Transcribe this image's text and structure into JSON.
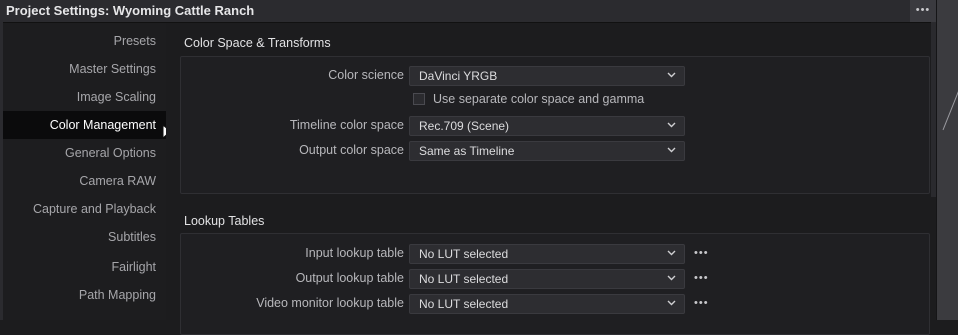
{
  "title": "Project Settings:  Wyoming Cattle Ranch",
  "header": {
    "more_label": "•••"
  },
  "sidebar": {
    "items": [
      {
        "label": "Presets",
        "active": false
      },
      {
        "label": "Master Settings",
        "active": false
      },
      {
        "label": "Image Scaling",
        "active": false
      },
      {
        "label": "Color Management",
        "active": true
      },
      {
        "label": "General Options",
        "active": false
      },
      {
        "label": "Camera RAW",
        "active": false
      },
      {
        "label": "Capture and Playback",
        "active": false
      },
      {
        "label": "Subtitles",
        "active": false
      },
      {
        "label": "Fairlight",
        "active": false
      },
      {
        "label": "Path Mapping",
        "active": false
      }
    ]
  },
  "color_space": {
    "section_title": "Color Space & Transforms",
    "color_science_label": "Color science",
    "color_science_value": "DaVinci YRGB",
    "separate_checkbox_label": "Use separate color space and gamma",
    "separate_checked": false,
    "timeline_label": "Timeline color space",
    "timeline_value": "Rec.709 (Scene)",
    "output_label": "Output color space",
    "output_value": "Same as Timeline"
  },
  "lookup_tables": {
    "section_title": "Lookup Tables",
    "input_label": "Input lookup table",
    "input_value": "No LUT selected",
    "output_label": "Output lookup table",
    "output_value": "No LUT selected",
    "video_monitor_label": "Video monitor lookup table",
    "video_monitor_value": "No LUT selected",
    "more_label": "•••"
  },
  "colors": {
    "background": "#1c1c1e",
    "active_item": "#0b0b0c",
    "dropdown": "#2d2d31",
    "titlebar": "#2b2b2f"
  }
}
